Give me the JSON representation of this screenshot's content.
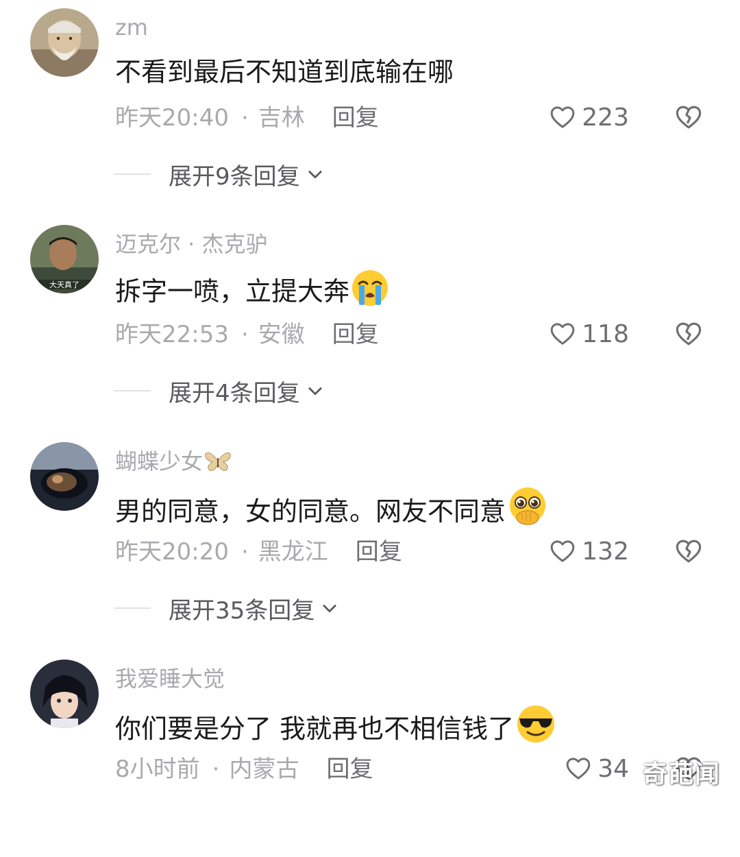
{
  "comments": [
    {
      "username": "zm",
      "text": "不看到最后不知道到底输在哪",
      "time": "昨天20:40",
      "location": "吉林",
      "reply_label": "回复",
      "likes": "223",
      "expand_label": "展开9条回复",
      "avatar_icon": "old-man-avatar"
    },
    {
      "username": "迈克尔 · 杰克驴",
      "text": "拆字一喷，立提大奔",
      "emoji": "loudly-crying-face-icon",
      "time": "昨天22:53",
      "location": "安徽",
      "reply_label": "回复",
      "likes": "118",
      "expand_label": "展开4条回复",
      "avatar_icon": "man-photo-avatar",
      "avatar_caption": "大天真了"
    },
    {
      "username": "蝴蝶少女",
      "username_emoji": "butterfly-icon",
      "text": "男的同意，女的同意。网友不同意",
      "emoji": "pleading-face-hands-icon",
      "time": "昨天20:20",
      "location": "黑龙江",
      "reply_label": "回复",
      "likes": "132",
      "expand_label": "展开35条回复",
      "avatar_icon": "car-mirror-avatar"
    },
    {
      "username": "我爱睡大觉",
      "text": "你们要是分了 我就再也不相信钱了",
      "emoji": "sunglasses-face-icon",
      "time": "8小时前",
      "location": "内蒙古",
      "reply_label": "回复",
      "likes": "34",
      "avatar_icon": "anime-boy-avatar"
    }
  ],
  "separator": "·",
  "watermark": "奇葩闻",
  "colors": {
    "meta_gray": "#a9a9ae",
    "text_dark": "#1a1a1a",
    "icon_gray": "#6e6e73"
  }
}
